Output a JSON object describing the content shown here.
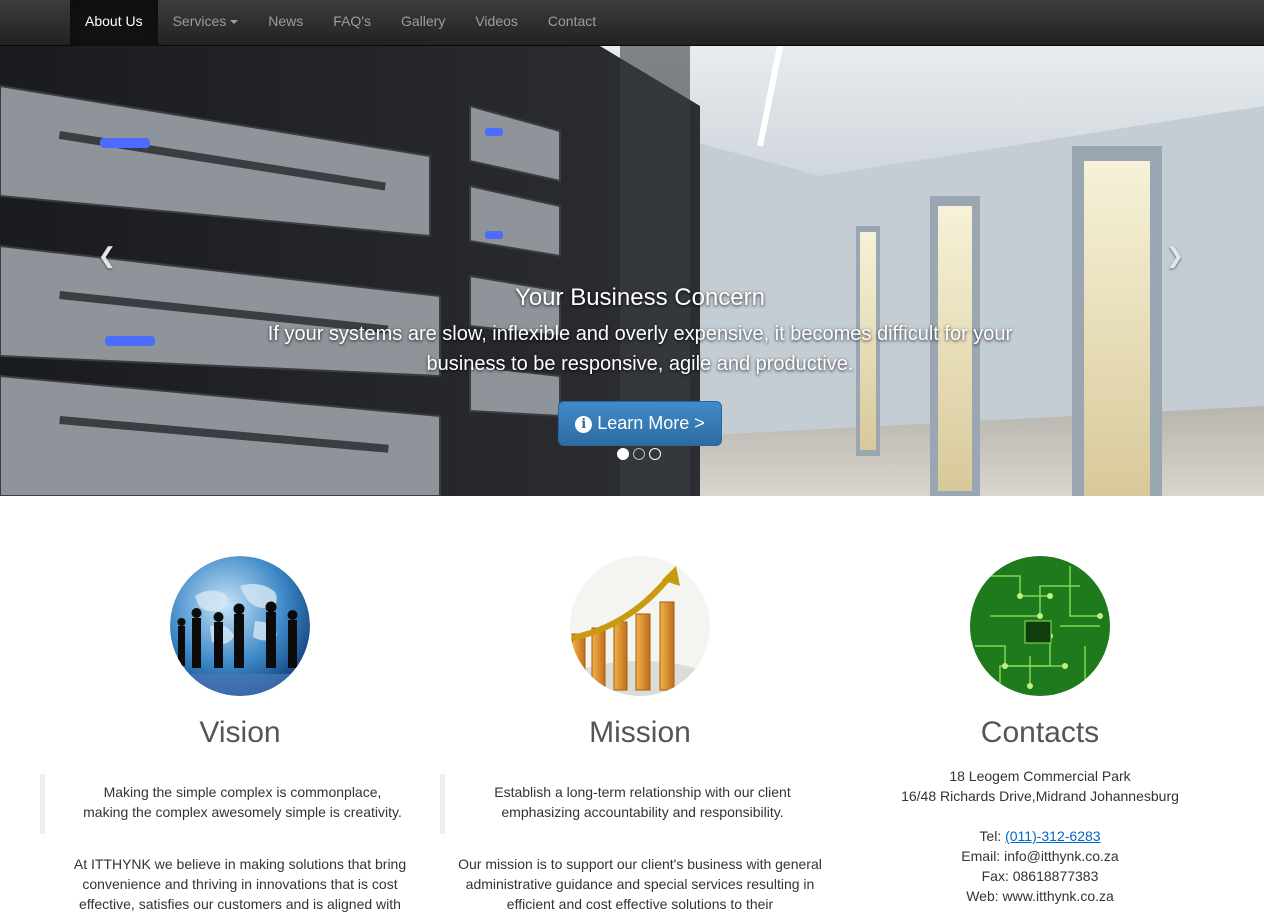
{
  "nav": {
    "items": [
      {
        "label": "About Us",
        "active": true
      },
      {
        "label": "Services",
        "dropdown": true
      },
      {
        "label": "News"
      },
      {
        "label": "FAQ's"
      },
      {
        "label": "Gallery"
      },
      {
        "label": "Videos"
      },
      {
        "label": "Contact"
      }
    ]
  },
  "carousel": {
    "title": "Your Business Concern",
    "text": "If your systems are slow, inflexible and overly expensive, it becomes difficult for your business to be responsive, agile and productive.",
    "button_label": "Learn More >",
    "button_icon": "info-circle-icon",
    "prev_icon": "chevron-left-icon",
    "next_icon": "chevron-right-icon",
    "slides": 3,
    "active_slide": 1
  },
  "features": {
    "vision": {
      "heading": "Vision",
      "image": "globe-business-people",
      "quote_line1": "Making the simple complex is commonplace,",
      "quote_line2": "making the complex awesomely simple is creativity.",
      "body": "At ITTHYNK we believe in making solutions that bring convenience and thriving in innovations that is cost effective, satisfies our customers and is aligned with"
    },
    "mission": {
      "heading": "Mission",
      "image": "rising-bar-chart",
      "quote_line1": "Establish a long-term relationship with our client",
      "quote_line2": "emphasizing accountability and responsibility.",
      "body": "Our mission is to support our client's business with general administrative guidance and special services resulting in efficient and cost effective solutions to their"
    },
    "contacts": {
      "heading": "Contacts",
      "image": "circuit-board",
      "address_line1": "18 Leogem Commercial Park",
      "address_line2": "16/48 Richards Drive,Midrand Johannesburg",
      "tel_label": "Tel:",
      "tel": "(011)-312-6283",
      "email": "Email: info@itthynk.co.za",
      "fax": "Fax: 08618877383",
      "web": "Web: www.itthynk.co.za"
    }
  },
  "colors": {
    "navbar": "#222222",
    "primary_button": "#428bca",
    "link": "#0066cc",
    "heading": "#555555"
  }
}
